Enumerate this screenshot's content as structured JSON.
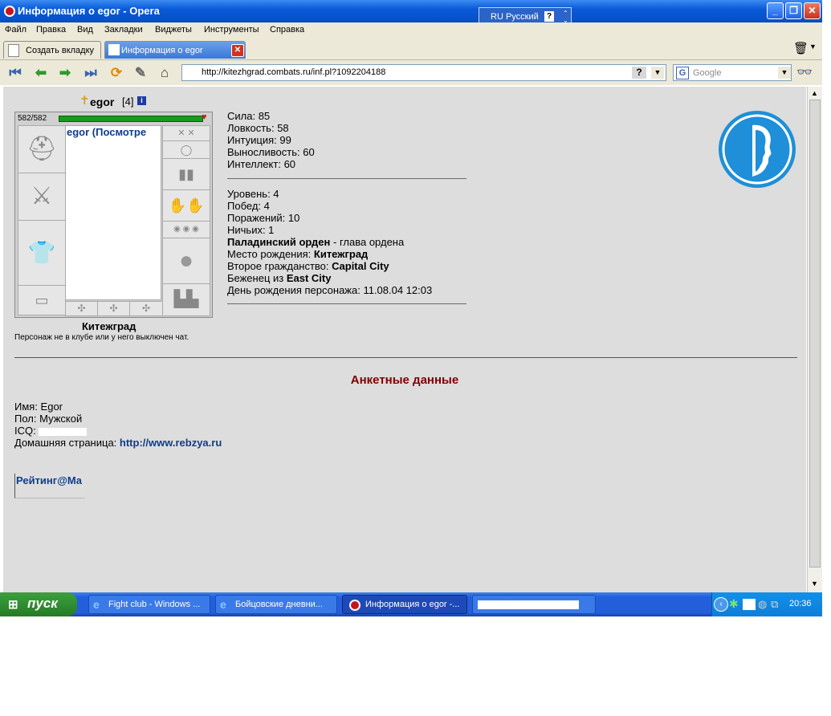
{
  "window": {
    "title": "Информация о egor - Opera",
    "language": "RU Русский",
    "lang_help": "?"
  },
  "menu": [
    "Файл",
    "Правка",
    "Вид",
    "Закладки",
    "Виджеты",
    "Инструменты",
    "Справка"
  ],
  "tabs": {
    "new_tab_label": "Создать вкладку",
    "active_tab_label": "Информация о egor"
  },
  "address": {
    "url": "http://kitezhgrad.combats.ru/inf.pl?1092204188",
    "help": "?",
    "search_placeholder": "Google"
  },
  "profile": {
    "name": "egor",
    "level": "[4]",
    "hp": "582/582",
    "inventory_label": "egor (Посмотре",
    "city": "Китежград",
    "status_note": "Персонаж не в клубе или у него выключен чат."
  },
  "stats": [
    {
      "label": "Сила:",
      "value": "85"
    },
    {
      "label": "Ловкость:",
      "value": "58"
    },
    {
      "label": "Интуиция:",
      "value": "99"
    },
    {
      "label": "Выносливость:",
      "value": "60"
    },
    {
      "label": "Интеллект:",
      "value": "60"
    }
  ],
  "info": {
    "level": "Уровень: 4",
    "wins": "Побед: 4",
    "losses": "Поражений: 10",
    "draws": "Ничьих: 1",
    "order": "Паладинский орден",
    "order_role": " - глава ордена",
    "birthplace_label": "Место рождения: ",
    "birthplace": "Китежград",
    "second_citizenship_label": "Второе гражданство: ",
    "second_citizenship": "Capital City",
    "refugee_label": "Беженец из ",
    "refugee_from": "East City",
    "birthday": "День рождения персонажа: 11.08.04 12:03"
  },
  "anketa": {
    "title": "Анкетные данные",
    "name": "Имя: Egor",
    "gender": "Пол: Мужской",
    "icq_label": "ICQ: ",
    "homepage_label": "Домашняя страница: ",
    "homepage_url": "http://www.rebzya.ru",
    "rating_label": "Рейтинг@Ma"
  },
  "taskbar": {
    "start": "пуск",
    "tasks": [
      "Fight club - Windows ...",
      "Бойцовские дневни...",
      "Информация о egor -..."
    ],
    "clock": "20:36"
  },
  "colors": {
    "title_blue": "#0a5ad8",
    "content_bg": "#dddddd",
    "link_blue": "#0e3c8c",
    "heading_red": "#800000",
    "order_logo": "#1e8fd8",
    "taskbar_blue": "#245edb"
  }
}
